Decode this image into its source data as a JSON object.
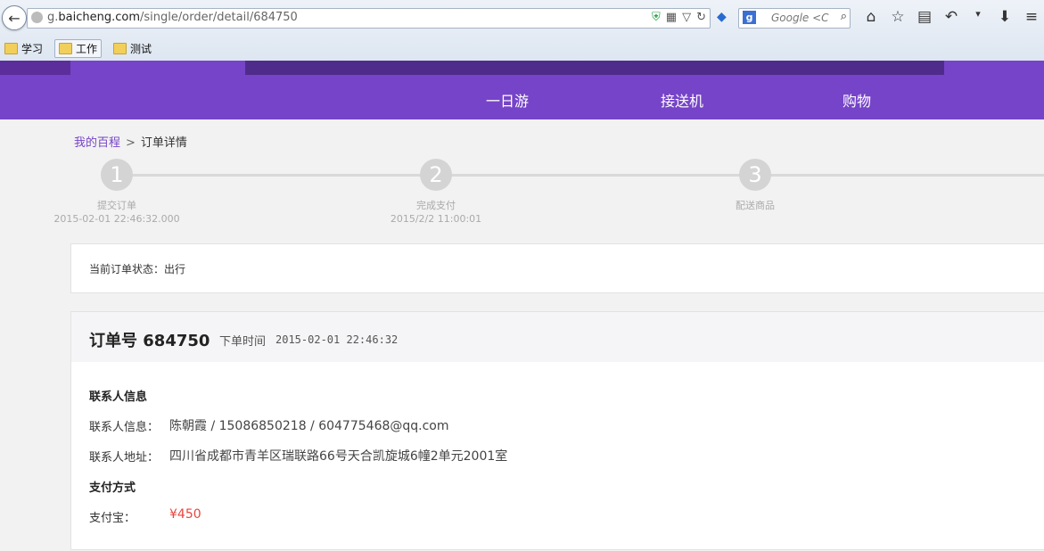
{
  "browser": {
    "url_prefix": "g.",
    "url_domain": "baicheng.com",
    "url_path": "/single/order/detail/684750",
    "search_placeholder": "Google <C",
    "search_engine_letter": "g",
    "bookmarks": [
      "学习",
      "工作",
      "测试"
    ]
  },
  "nav": {
    "items": [
      "一日游",
      "接送机",
      "购物"
    ]
  },
  "breadcrumb": {
    "home": "我的百程",
    "sep": ">",
    "current": "订单详情"
  },
  "steps": [
    {
      "number": "1",
      "label": "提交订单",
      "time": "2015-02-01 22:46:32.000"
    },
    {
      "number": "2",
      "label": "完成支付",
      "time": "2015/2/2 11:00:01"
    },
    {
      "number": "3",
      "label": "配送商品",
      "time": ""
    }
  ],
  "status": {
    "text": "当前订单状态：出行"
  },
  "order": {
    "number_label": "订单号 684750",
    "time_label": "下单时间",
    "time_value": "2015-02-01 22:46:32",
    "contact_section": "联系人信息",
    "contact_label": "联系人信息：",
    "contact_value": "陈朝霞 / 15086850218 / 604775468@qq.com",
    "address_label": "联系人地址：",
    "address_value": "四川省成都市青羊区瑞联路66号天合凯旋城6幢2单元2001室",
    "payment_section": "支付方式",
    "payment_label": "支付宝：",
    "payment_value": "¥450"
  },
  "colors": {
    "brand_purple": "#7644c8",
    "price_red": "#e8453c"
  }
}
